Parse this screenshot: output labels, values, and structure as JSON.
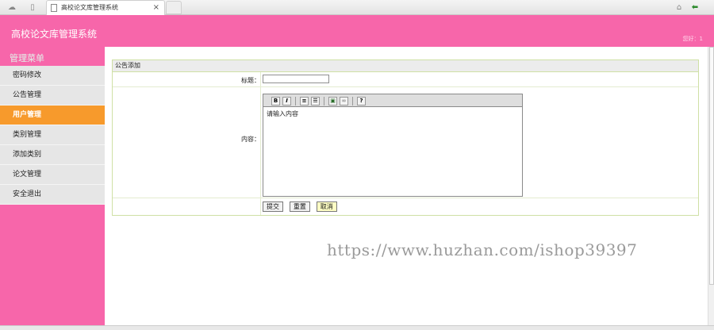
{
  "browser": {
    "tab_title": "高校论文库管理系统",
    "tab_close": "×"
  },
  "header": {
    "title": "高校论文库管理系统",
    "welcome": "您好：1"
  },
  "sidebar": {
    "menu_title": "管理菜单",
    "items": [
      {
        "label": "密码修改"
      },
      {
        "label": "公告管理"
      },
      {
        "label": "用户管理",
        "active": true
      },
      {
        "label": "类别管理"
      },
      {
        "label": "添加类别"
      },
      {
        "label": "论文管理"
      },
      {
        "label": "安全退出"
      }
    ]
  },
  "form": {
    "heading": "公告添加",
    "title_label": "标题：",
    "title_value": "",
    "content_label": "内容：",
    "editor_default": "请输入内容",
    "toolbar": [
      "bold-icon",
      "italic-icon",
      "ordered-list-icon",
      "unordered-list-icon",
      "image-icon",
      "link-icon",
      "help-icon"
    ],
    "buttons": {
      "submit": "提交",
      "reset": "重置",
      "cancel": "取消"
    }
  },
  "watermark": "https://www.huzhan.com/ishop39397",
  "colors": {
    "header": "#f766aa",
    "active_menu": "#f79a2c",
    "panel_border": "#cfe0a5"
  }
}
